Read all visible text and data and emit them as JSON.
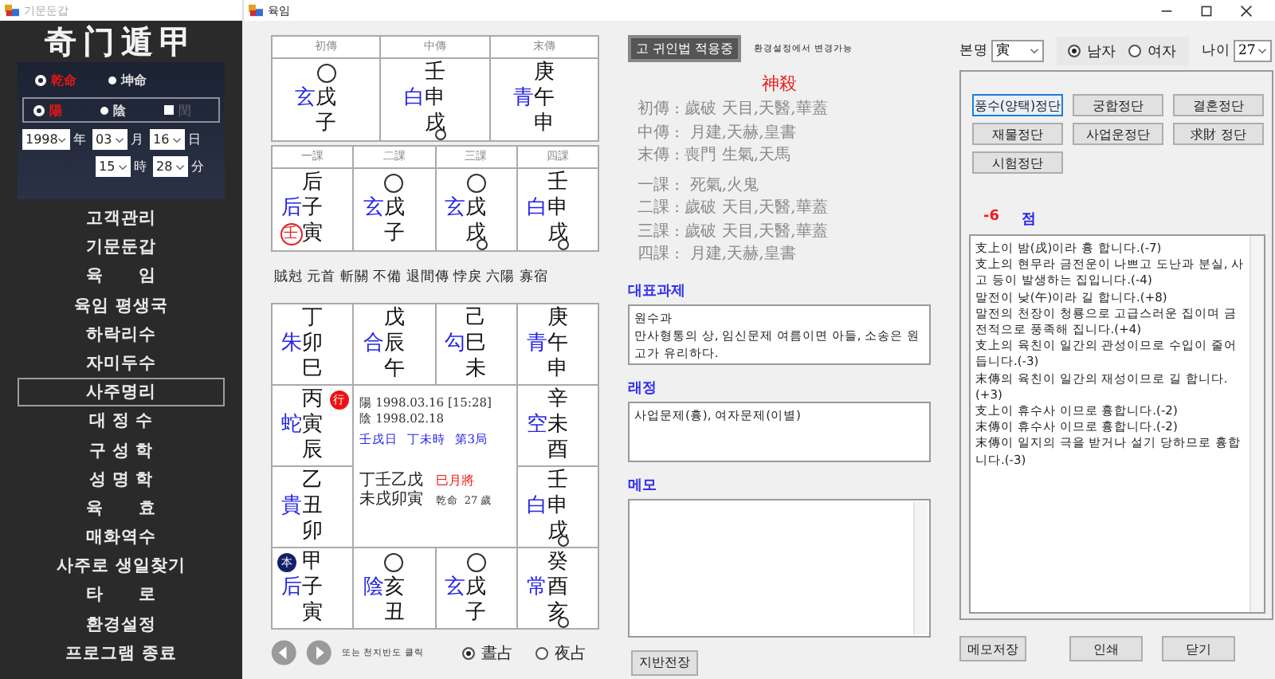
{
  "sidebar_window": {
    "title": "기문둔갑"
  },
  "sidebar": {
    "logo": "奇门遁甲",
    "gender_options": [
      {
        "label": "乾命",
        "selected": true
      },
      {
        "label": "坤命",
        "selected": false
      }
    ],
    "calendar_options": [
      {
        "label": "陽",
        "selected": true
      },
      {
        "label": "陰",
        "selected": false
      }
    ],
    "leap_month": {
      "label": "閏",
      "checked": false
    },
    "date_fields": [
      {
        "value": "1998",
        "unit": "年"
      },
      {
        "value": "03",
        "unit": "月"
      },
      {
        "value": "16",
        "unit": "日"
      },
      {
        "value": "15",
        "unit": "時"
      },
      {
        "value": "28",
        "unit": "分"
      }
    ],
    "menu": [
      {
        "label": "고객관리",
        "selected": false
      },
      {
        "label": "기문둔갑",
        "selected": false
      },
      {
        "label": "육      임",
        "selected": false
      },
      {
        "label": "육임 평생국",
        "selected": false
      },
      {
        "label": "하락리수",
        "selected": false
      },
      {
        "label": "자미두수",
        "selected": false
      },
      {
        "label": "사주명리",
        "selected": true
      },
      {
        "label": "대 정 수",
        "selected": false
      },
      {
        "label": "구 성 학",
        "selected": false
      },
      {
        "label": "성 명 학",
        "selected": false
      },
      {
        "label": "육      효",
        "selected": false
      },
      {
        "label": "매화역수",
        "selected": false
      },
      {
        "label": "사주로 생일찾기",
        "selected": false
      },
      {
        "label": "타      로",
        "selected": false
      },
      {
        "label": "환경설정",
        "selected": false
      },
      {
        "label": "프로그램 종료",
        "selected": false
      }
    ]
  },
  "window": {
    "title": "육임"
  },
  "three_transmissions": [
    {
      "header": "初傳",
      "cell": {
        "god": "玄",
        "middle": "戌",
        "bottom": "子",
        "void_top": true,
        "void_bottom": false
      }
    },
    {
      "header": "中傳",
      "cell": {
        "top": "壬",
        "god": "白",
        "middle": "申",
        "bottom": "戌",
        "void_top": false,
        "void_bottom": true
      }
    },
    {
      "header": "末傳",
      "cell": {
        "top": "庚",
        "god": "青",
        "middle": "午",
        "bottom": "申",
        "void_top": false,
        "void_bottom": false
      }
    }
  ],
  "four_lessons": [
    {
      "header": "一課",
      "cell": {
        "top": "后",
        "god": "后",
        "middle": "子",
        "bottom": "寅",
        "void_top": false,
        "void_bottom": false,
        "badge": {
          "text": "壬",
          "kind": "ring",
          "color": "#e02020"
        }
      }
    },
    {
      "header": "二課",
      "cell": {
        "god": "玄",
        "middle": "戌",
        "bottom": "子",
        "void_top": true,
        "void_bottom": false
      }
    },
    {
      "header": "三課",
      "cell": {
        "god": "玄",
        "middle": "戌",
        "bottom": "戌",
        "void_top": true,
        "void_bottom": true
      }
    },
    {
      "header": "四課",
      "cell": {
        "top": "壬",
        "god": "白",
        "middle": "申",
        "bottom": "戌",
        "void_top": false,
        "void_bottom": true
      }
    }
  ],
  "pattern_names": "賊尅 元首 斬關 不備 退間傳 悖戾 六陽 寡宿",
  "board": {
    "cells": [
      {
        "top": "丁",
        "god": "朱",
        "middle": "卯",
        "bottom": "巳",
        "void_top": false,
        "void_bottom": false
      },
      {
        "top": "戊",
        "god": "合",
        "middle": "辰",
        "bottom": "午",
        "void_top": false,
        "void_bottom": false
      },
      {
        "top": "己",
        "god": "勾",
        "middle": "巳",
        "bottom": "未",
        "void_top": false,
        "void_bottom": false
      },
      {
        "top": "庚",
        "god": "青",
        "middle": "午",
        "bottom": "申",
        "void_top": false,
        "void_bottom": false
      },
      {
        "top": "丙",
        "god": "蛇",
        "middle": "寅",
        "bottom": "辰",
        "void_top": false,
        "void_bottom": false,
        "badge": {
          "text": "行",
          "kind": "dot-after",
          "color": "#ee1111"
        }
      },
      {
        "top": "辛",
        "god": "空",
        "middle": "未",
        "bottom": "酉",
        "void_top": false,
        "void_bottom": false
      },
      {
        "top": "乙",
        "god": "貴",
        "middle": "丑",
        "bottom": "卯",
        "void_top": false,
        "void_bottom": false
      },
      {
        "top": "壬",
        "god": "白",
        "middle": "申",
        "bottom": "戌",
        "void_top": false,
        "void_bottom": true
      },
      {
        "top": "甲",
        "god": "后",
        "middle": "子",
        "bottom": "寅",
        "void_top": false,
        "void_bottom": false,
        "badge": {
          "text": "本",
          "kind": "dot-before",
          "color": "#14206a"
        }
      },
      {
        "god": "陰",
        "middle": "亥",
        "bottom": "丑",
        "void_top": true,
        "void_bottom": false
      },
      {
        "god": "玄",
        "middle": "戌",
        "bottom": "子",
        "void_top": true,
        "void_bottom": false
      },
      {
        "top": "癸",
        "god": "常",
        "middle": "酉",
        "bottom": "亥",
        "void_top": false,
        "void_bottom": true
      }
    ],
    "center": {
      "solar_date": "陽 1998.03.16 [15:28]",
      "lunar_date": "陰 1998.02.18",
      "day_time": [
        "壬戌日",
        "丁未時",
        "第3局"
      ],
      "stems": "丁壬乙戊",
      "branches": "未戌卯寅",
      "month_general": "巳月將",
      "birth_info": "乾命  27 歲"
    }
  },
  "navigation": {
    "hint": "또는 천지반도 클릭",
    "time_options": [
      {
        "label": "晝占",
        "selected": true
      },
      {
        "label": "夜占",
        "selected": false
      }
    ]
  },
  "guiin_button": "고 귀인법 적용중",
  "guiin_note": "환경설정에서 변경가능",
  "spirit_killers": {
    "title": "神殺",
    "transmissions": [
      "初傳 : 歲破 天目,天醫,華蓋",
      "中傳 :  月建,天赫,皇書",
      "末傳 : 喪門 生氣,天馬"
    ],
    "lessons": [
      "一課 :  死氣,火鬼",
      "二課 : 歲破 天目,天醫,華蓋",
      "三課 : 歲破 天目,天醫,華蓋",
      "四課 :  月建,天赫,皇書"
    ]
  },
  "representative_lesson": {
    "label": "대표과제",
    "lines": [
      "원수과",
      "만사형통의 상, 임신문제 여름이면 아들, 소송은 원고가 유리하다."
    ]
  },
  "forecast": {
    "label": "래정",
    "text": "사업문제(흉), 여자문제(이별)"
  },
  "memo": {
    "label": "메모"
  },
  "map_button": "지반전장",
  "birth_branch": {
    "label": "본명",
    "value": "寅"
  },
  "sex_options": [
    {
      "label": "남자",
      "selected": true
    },
    {
      "label": "여자",
      "selected": false
    }
  ],
  "age": {
    "label": "나이",
    "value": "27"
  },
  "judgement_buttons": [
    {
      "label": "풍수(양택)정단",
      "selected": true
    },
    {
      "label": "궁합정단",
      "selected": false
    },
    {
      "label": "결혼정단",
      "selected": false
    },
    {
      "label": "재물정단",
      "selected": false
    },
    {
      "label": "사업운정단",
      "selected": false
    },
    {
      "label": "求財 정단",
      "selected": false
    },
    {
      "label": "시험정단",
      "selected": false
    }
  ],
  "score": {
    "value": "-6",
    "unit": "점"
  },
  "results": [
    "支上이 밤(戌)이라 흉 합니다.(-7)",
    "支上의 현무라 금전운이 나쁘고 도난과 분실, 사고 등이 발생하는 집입니다.(-4)",
    "말전이 낮(午)이라 길 합니다.(+8)",
    "말전의 천장이 청룡으로 고급스러운 집이며 금전적으로 풍족해 집니다.(+4)",
    "支上의 육친이 일간의 관성이므로 수입이 줄어 듭니다.(-3)",
    "末傳의 육친이 일간의 재성이므로 길 합니다.(+3)",
    "支上이 휴수사 이므로 흉합니다.(-2)",
    "末傳이 휴수사 이므로 흉합니다.(-2)",
    "末傳이 일지의 극을 받거나 설기 당하므로 흉합니다.(-3)"
  ],
  "footer_buttons": [
    "메모저장",
    "인쇄",
    "닫기"
  ]
}
